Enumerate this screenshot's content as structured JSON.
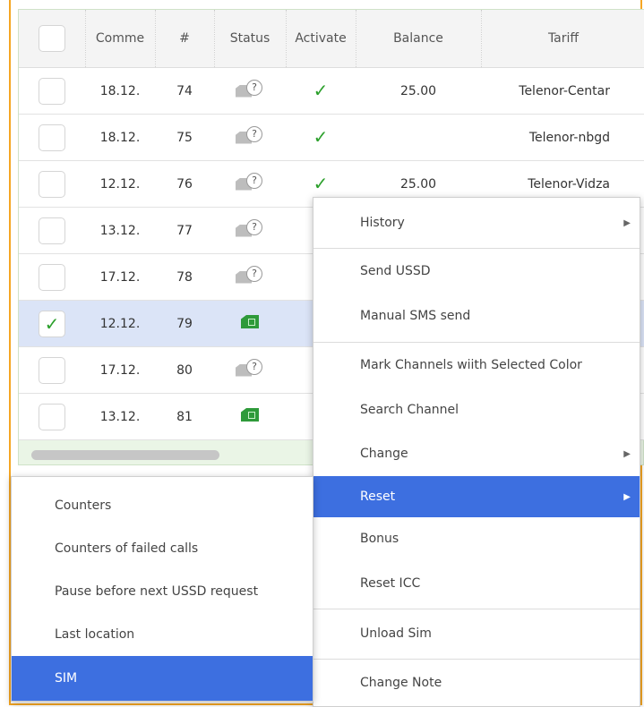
{
  "grid": {
    "columns": [
      "Comme",
      "#",
      "Status",
      "Activate",
      "Balance",
      "Tariff"
    ],
    "rows": [
      {
        "date": "18.12.",
        "num": "74",
        "status": "unknown",
        "activated": true,
        "balance": "25.00",
        "tariff": "Telenor-Centar",
        "checked": false
      },
      {
        "date": "18.12.",
        "num": "75",
        "status": "unknown",
        "activated": true,
        "balance": "",
        "tariff": "Telenor-nbgd",
        "checked": false
      },
      {
        "date": "12.12.",
        "num": "76",
        "status": "unknown",
        "activated": true,
        "balance": "25.00",
        "tariff": "Telenor-Vidza",
        "checked": false
      },
      {
        "date": "13.12.",
        "num": "77",
        "status": "unknown",
        "activated": false,
        "balance": "",
        "tariff": "",
        "checked": false
      },
      {
        "date": "17.12.",
        "num": "78",
        "status": "unknown",
        "activated": false,
        "balance": "",
        "tariff": "",
        "checked": false
      },
      {
        "date": "12.12.",
        "num": "79",
        "status": "ok",
        "activated": false,
        "balance": "",
        "tariff": "",
        "checked": true
      },
      {
        "date": "17.12.",
        "num": "80",
        "status": "unknown",
        "activated": false,
        "balance": "",
        "tariff": "",
        "checked": false
      },
      {
        "date": "13.12.",
        "num": "81",
        "status": "ok",
        "activated": false,
        "balance": "",
        "tariff": "",
        "checked": false
      }
    ]
  },
  "context_menu": {
    "items": [
      {
        "label": "History",
        "submenu": true
      },
      {
        "label": "Send USSD"
      },
      {
        "label": "Manual SMS send"
      },
      {
        "label": "Mark Channels wiith Selected Color"
      },
      {
        "label": "Search Channel"
      },
      {
        "label": "Change",
        "submenu": true
      },
      {
        "label": "Reset",
        "submenu": true,
        "active": true
      },
      {
        "label": "Bonus"
      },
      {
        "label": "Reset ICC"
      },
      {
        "label": "Unload Sim"
      },
      {
        "label": "Change Note"
      }
    ]
  },
  "submenu": {
    "items": [
      {
        "label": "Counters"
      },
      {
        "label": "Counters of failed calls"
      },
      {
        "label": "Pause before next USSD request"
      },
      {
        "label": "Last location"
      },
      {
        "label": "SIM",
        "active": true
      }
    ]
  },
  "colors": {
    "accent": "#3d6fe0",
    "check": "#2ca02c",
    "selected_row": "#dbe4f7",
    "frame": "#f5a623"
  }
}
